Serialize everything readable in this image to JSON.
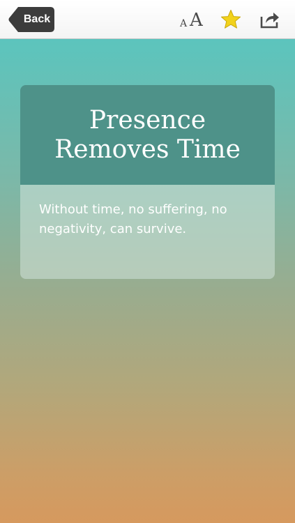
{
  "navbar": {
    "back_label": "Back",
    "font_size_small": "A",
    "font_size_large": "A",
    "favorite_icon": "star-icon",
    "share_icon": "share-icon"
  },
  "colors": {
    "back_button_bg": "#3c3c3c",
    "star_fill": "#f2d21b",
    "card_header_bg": "#4e9289",
    "gradient_top": "#56c8c2",
    "gradient_bottom": "#d6995e"
  },
  "card": {
    "title": "Presence Removes Time",
    "body": "Without time, no suffering, no negativity, can survive."
  }
}
